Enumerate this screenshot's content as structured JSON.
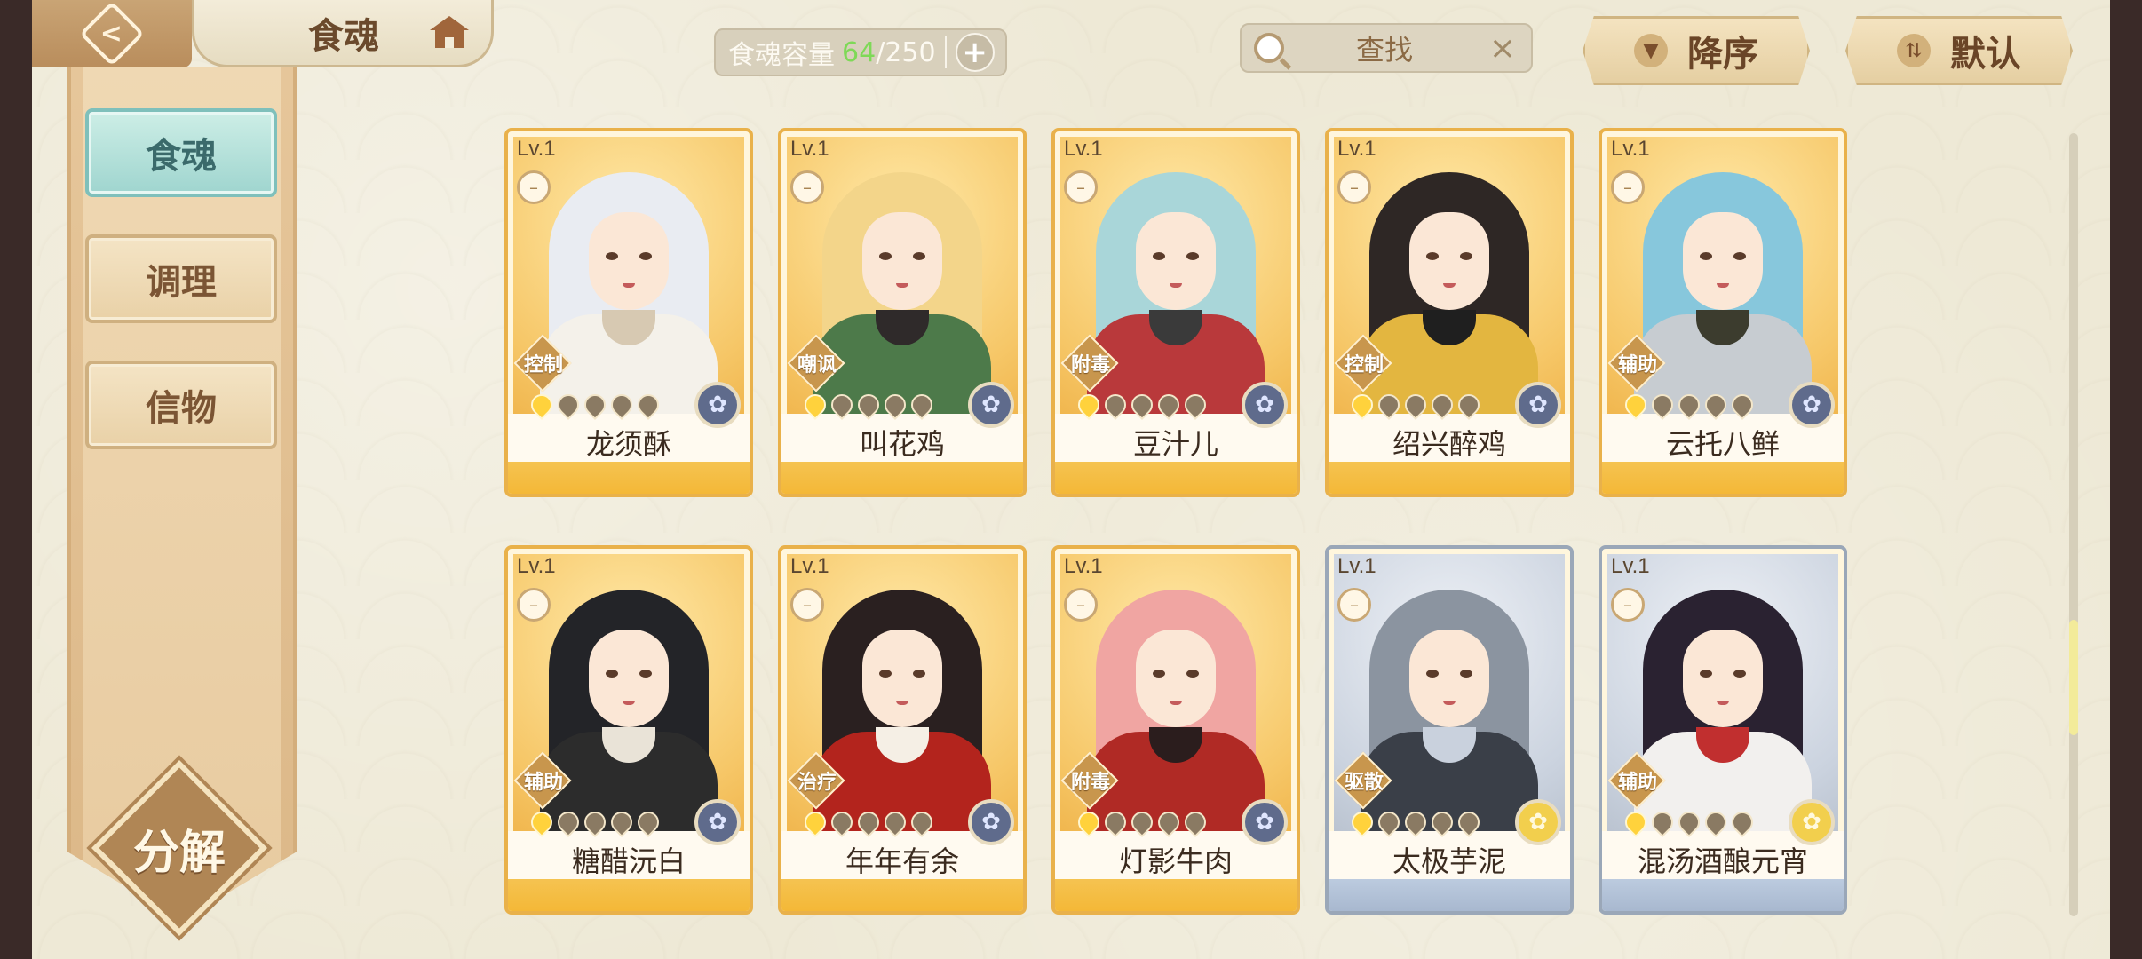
{
  "header": {
    "title": "食魂",
    "capacity_label": "食魂容量",
    "capacity_current": "64",
    "capacity_sep": "/",
    "capacity_max": "250",
    "plus": "+",
    "search_placeholder": "查找",
    "close": "×",
    "sort_desc": "降序",
    "sort_default": "默认"
  },
  "sidebar": {
    "tabs": [
      {
        "label": "食魂",
        "active": true
      },
      {
        "label": "调理",
        "active": false
      },
      {
        "label": "信物",
        "active": false
      }
    ],
    "decompose": "分解"
  },
  "cards": [
    {
      "lv": "Lv.1",
      "role": "控制",
      "name": "龙须酥",
      "stars": 1,
      "frame": "gold",
      "badge": "dark"
    },
    {
      "lv": "Lv.1",
      "role": "嘲讽",
      "name": "叫花鸡",
      "stars": 1,
      "frame": "gold",
      "badge": "dark"
    },
    {
      "lv": "Lv.1",
      "role": "附毒",
      "name": "豆汁儿",
      "stars": 1,
      "frame": "gold",
      "badge": "dark"
    },
    {
      "lv": "Lv.1",
      "role": "控制",
      "name": "绍兴醉鸡",
      "stars": 1,
      "frame": "gold",
      "badge": "dark"
    },
    {
      "lv": "Lv.1",
      "role": "辅助",
      "name": "云托八鲜",
      "stars": 1,
      "frame": "gold",
      "badge": "dark"
    },
    {
      "lv": "Lv.1",
      "role": "辅助",
      "name": "糖醋沅白",
      "stars": 1,
      "frame": "gold",
      "badge": "dark"
    },
    {
      "lv": "Lv.1",
      "role": "治疗",
      "name": "年年有余",
      "stars": 1,
      "frame": "gold",
      "badge": "dark"
    },
    {
      "lv": "Lv.1",
      "role": "附毒",
      "name": "灯影牛肉",
      "stars": 1,
      "frame": "gold",
      "badge": "dark"
    },
    {
      "lv": "Lv.1",
      "role": "驱散",
      "name": "太极芋泥",
      "stars": 1,
      "frame": "silver",
      "badge": "yellow"
    },
    {
      "lv": "Lv.1",
      "role": "辅助",
      "name": "混汤酒酿元宵",
      "stars": 1,
      "frame": "silver",
      "badge": "yellow"
    }
  ],
  "colors": {
    "capacity_current": "#7ed957",
    "active_tab": "#9fd5cf",
    "gold_frame": "#e9b14a",
    "silver_frame": "#9aa7b8"
  },
  "icons": [
    "back-icon",
    "home-icon",
    "plus-icon",
    "search-icon",
    "close-icon",
    "sort-desc-icon",
    "sort-default-icon",
    "expression-icon",
    "element-badge-icon",
    "star-icon"
  ]
}
